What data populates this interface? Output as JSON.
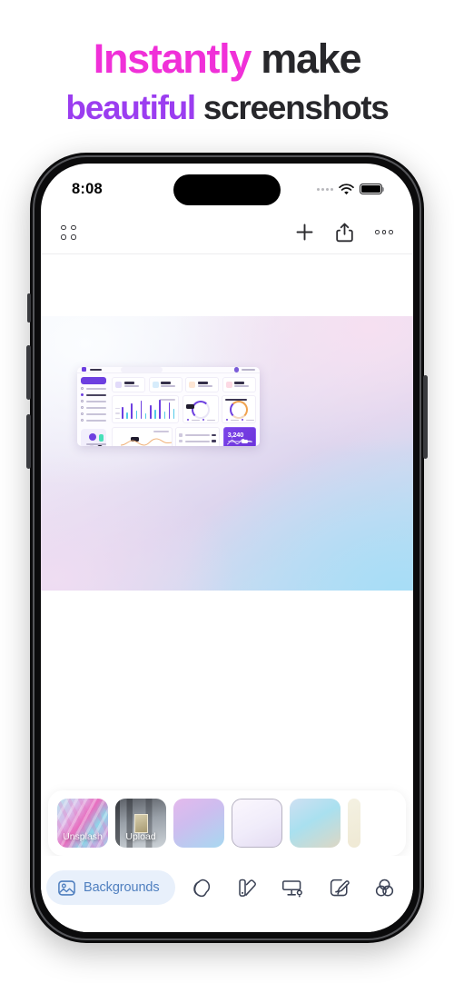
{
  "headline": {
    "line1_accent": "Instantly",
    "line1_rest": " make",
    "line2_accent": "beautiful",
    "line2_rest": " screenshots",
    "accent_pink": "#f030d8",
    "accent_purple": "#9b3df0",
    "text_dark": "#27272b"
  },
  "status_bar": {
    "time": "8:08",
    "wifi_icon": "wifi-icon",
    "battery_icon": "battery-icon",
    "signal_icon": "signal-dots-icon",
    "dynamic_island": "dynamic-island"
  },
  "app_toolbar": {
    "grid_icon": "grid-dots-icon",
    "add_icon": "plus-icon",
    "share_icon": "share-icon",
    "more_icon": "more-ellipsis-icon"
  },
  "canvas": {
    "gradient_name": "pastel-lilac-blue",
    "gradient_colors": [
      "#f3f6fb",
      "#e9e3f4",
      "#efddf2",
      "#f6e0f1",
      "#bfe0f4",
      "#a7ddf6"
    ],
    "content": "dashboard-screenshot"
  },
  "dashboard": {
    "brand": "dashboard-logo",
    "search_placeholder": "Search...",
    "cta_label": "Register patient",
    "highlight_value": "3,240",
    "accent_purple": "#6d3fe0",
    "accent_cyan": "#53c9e8",
    "accent_orange": "#f0a24f",
    "stat_icon_colors": [
      "#e2dbfa",
      "#d6ecfb",
      "#fde6d4",
      "#fcd9e4"
    ]
  },
  "background_tray": {
    "thumbnails": [
      {
        "name": "unsplash",
        "label": "Unsplash"
      },
      {
        "name": "upload",
        "label": "Upload"
      },
      {
        "name": "gradient-violet-blue",
        "label": ""
      },
      {
        "name": "gradient-white-lilac",
        "label": "",
        "selected": true
      },
      {
        "name": "gradient-blue-sand",
        "label": ""
      },
      {
        "name": "gradient-cream",
        "label": ""
      }
    ]
  },
  "tab_bar": {
    "active": {
      "label": "Backgrounds",
      "icon": "image-icon"
    },
    "active_bg": "#e8f0fb",
    "active_fg": "#4f7fbf",
    "items": [
      {
        "name": "shadow",
        "icon": "shadow-layers-icon"
      },
      {
        "name": "color",
        "icon": "color-swatches-icon"
      },
      {
        "name": "frame",
        "icon": "device-frame-icon"
      },
      {
        "name": "annotate",
        "icon": "brush-icon"
      },
      {
        "name": "effects",
        "icon": "overlapping-circles-icon"
      }
    ]
  }
}
